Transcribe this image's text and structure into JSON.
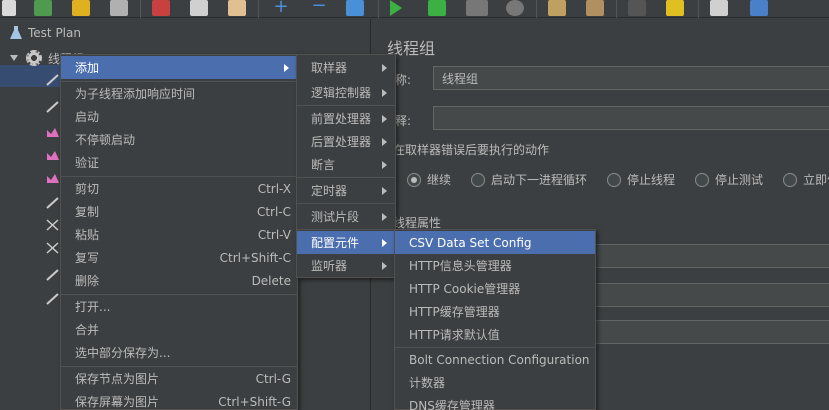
{
  "tree": {
    "test_plan": "Test Plan",
    "thread_group": "线程组"
  },
  "panel": {
    "title": "线程组",
    "name_label": "称:",
    "name_value": "线程组",
    "comment_label": "释:",
    "comment_value": "",
    "error_action_title": "在取样器错误后要执行的动作",
    "error_actions": [
      {
        "label": "继续",
        "selected": true
      },
      {
        "label": "启动下一进程循环",
        "selected": false
      },
      {
        "label": "停止线程",
        "selected": false
      },
      {
        "label": "停止测试",
        "selected": false
      },
      {
        "label": "立即停",
        "selected": false
      }
    ],
    "thread_props_title": "线程属性"
  },
  "context_menu": {
    "items": [
      {
        "label": "添加",
        "shortcut": "",
        "submenu": true,
        "highlighted": true
      },
      {
        "label": "为子线程添加响应时间",
        "shortcut": ""
      },
      {
        "label": "启动",
        "shortcut": ""
      },
      {
        "label": "不停顿启动",
        "shortcut": ""
      },
      {
        "label": "验证",
        "shortcut": ""
      },
      {
        "label": "剪切",
        "shortcut": "Ctrl-X"
      },
      {
        "label": "复制",
        "shortcut": "Ctrl-C"
      },
      {
        "label": "粘贴",
        "shortcut": "Ctrl-V"
      },
      {
        "label": "复写",
        "shortcut": "Ctrl+Shift-C"
      },
      {
        "label": "删除",
        "shortcut": "Delete"
      },
      {
        "label": "打开...",
        "shortcut": ""
      },
      {
        "label": "合并",
        "shortcut": ""
      },
      {
        "label": "选中部分保存为...",
        "shortcut": ""
      },
      {
        "label": "保存节点为图片",
        "shortcut": "Ctrl-G"
      },
      {
        "label": "保存屏幕为图片",
        "shortcut": "Ctrl+Shift-G"
      }
    ]
  },
  "add_submenu": {
    "items": [
      {
        "label": "取样器"
      },
      {
        "label": "逻辑控制器"
      },
      {
        "label": "前置处理器"
      },
      {
        "label": "后置处理器"
      },
      {
        "label": "断言"
      },
      {
        "label": "定时器"
      },
      {
        "label": "测试片段"
      },
      {
        "label": "配置元件",
        "highlighted": true
      },
      {
        "label": "监听器"
      }
    ]
  },
  "config_submenu": {
    "items": [
      {
        "label": "CSV Data Set Config",
        "highlighted": true
      },
      {
        "label": "HTTP信息头管理器"
      },
      {
        "label": "HTTP Cookie管理器"
      },
      {
        "label": "HTTP缓存管理器"
      },
      {
        "label": "HTTP请求默认值"
      },
      {
        "label": "Bolt Connection Configuration"
      },
      {
        "label": "计数器"
      },
      {
        "label": "DNS缓存管理器"
      }
    ]
  },
  "colors": {
    "background": "#3c3f41",
    "highlight": "#4b6eaf",
    "text": "#bbbbbb"
  }
}
